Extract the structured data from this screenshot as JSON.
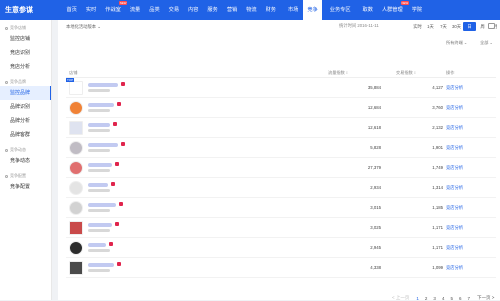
{
  "topbar": {
    "brand": "生意参谋",
    "nav": [
      {
        "label": "首页"
      },
      {
        "label": "实时"
      },
      {
        "label": "作战室",
        "badge": "NEW"
      },
      {
        "label": "流量"
      },
      {
        "label": "品类"
      },
      {
        "label": "交易"
      },
      {
        "label": "内容"
      },
      {
        "label": "服务"
      },
      {
        "label": "营销"
      },
      {
        "label": "物流"
      },
      {
        "label": "财务"
      },
      {
        "label": "市场",
        "sep": true
      },
      {
        "label": "竞争",
        "active": true
      },
      {
        "label": "业务专区",
        "sep": true
      },
      {
        "label": "取数",
        "sep": true
      },
      {
        "label": "人群管理",
        "badge": "NEW"
      },
      {
        "label": "学院"
      }
    ]
  },
  "sidebar": {
    "groups": [
      {
        "title": "竞争店铺",
        "items": [
          "监控店铺",
          "竞店识别",
          "竞店分析"
        ]
      },
      {
        "title": "竞争品牌",
        "items": [
          "监控品牌",
          "品牌识别",
          "品牌分析",
          "品牌客群"
        ]
      },
      {
        "title": "竞争动态",
        "items": [
          "竞争动态"
        ]
      },
      {
        "title": "竞争配置",
        "items": [
          "竞争配置"
        ]
      }
    ],
    "active_item": "监控品牌"
  },
  "toolbar": {
    "crumb": "本地化活动版本 ⌄",
    "stat_time_label": "统计时间 2016-11-11",
    "ranges": [
      "实时",
      "1天",
      "7天",
      "30天",
      "日",
      "周",
      "月"
    ],
    "active_range": "日"
  },
  "filters": {
    "a": "所有终端 ⌄",
    "b": "全部 ⌄"
  },
  "table": {
    "headers": {
      "name": "店铺",
      "flow": "流量指数 ↕",
      "sales": "交易指数 ↕",
      "action": "操作"
    },
    "rows": [
      {
        "flow": "35,884",
        "sales": "4,127",
        "action": "竞店分析",
        "color": "#ffffff",
        "top_tag": "TOP",
        "square": true
      },
      {
        "flow": "12,684",
        "sales": "3,760",
        "action": "竞店分析",
        "color": "#f08236"
      },
      {
        "flow": "12,618",
        "sales": "2,132",
        "action": "竞店分析",
        "color": "#dfe3f0",
        "square": true
      },
      {
        "flow": "5,828",
        "sales": "1,901",
        "action": "竞店分析",
        "color": "#c0bcc4"
      },
      {
        "flow": "27,379",
        "sales": "1,749",
        "action": "竞店分析",
        "color": "#e06f6f"
      },
      {
        "flow": "2,934",
        "sales": "1,314",
        "action": "竞店分析",
        "color": "#e4e4e4"
      },
      {
        "flow": "3,015",
        "sales": "1,185",
        "action": "竞店分析",
        "color": "#d2d2d2"
      },
      {
        "flow": "3,025",
        "sales": "1,171",
        "action": "竞店分析",
        "color": "#c94a4a",
        "square": true
      },
      {
        "flow": "2,945",
        "sales": "1,171",
        "action": "竞店分析",
        "color": "#2d2d2d"
      },
      {
        "flow": "4,338",
        "sales": "1,099",
        "action": "竞店分析",
        "color": "#4b4b4b",
        "square": true
      }
    ]
  },
  "pager": {
    "prev": "< 上一页",
    "pages": [
      "1",
      "2",
      "3",
      "4",
      "5",
      "6",
      "7"
    ],
    "active_page": "1",
    "next": "下一页 >"
  },
  "colors": {
    "accent": "#2062e6"
  }
}
